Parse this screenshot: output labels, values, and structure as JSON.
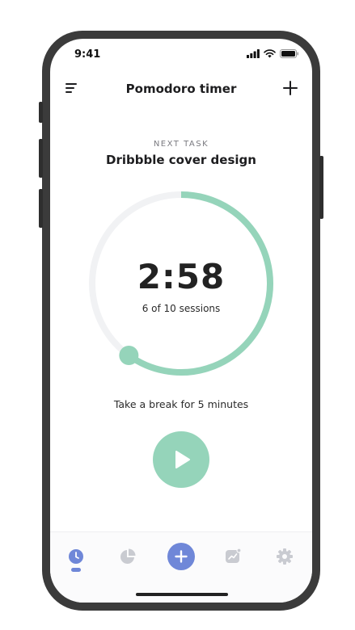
{
  "status_bar": {
    "time": "9:41",
    "icons": [
      "signal-icon",
      "wifi-icon",
      "battery-icon"
    ]
  },
  "header": {
    "title": "Pomodoro timer",
    "menu_icon": "menu-icon",
    "add_icon": "plus-icon"
  },
  "task": {
    "label": "NEXT TASK",
    "name": "Dribbble cover design"
  },
  "timer": {
    "time_left": "2:58",
    "sessions_text": "6 of 10 sessions",
    "progress_fraction": 0.6
  },
  "break_text": "Take a break for 5 minutes",
  "play_icon": "play-icon",
  "tabbar": {
    "tabs": [
      {
        "icon": "clock-icon",
        "active": true
      },
      {
        "icon": "pie-chart-icon",
        "active": false
      },
      {
        "icon": "plus-icon",
        "active": false
      },
      {
        "icon": "trend-chart-icon",
        "active": false
      },
      {
        "icon": "gear-icon",
        "active": false
      }
    ]
  },
  "colors": {
    "accent_green": "#95d4ba",
    "accent_blue": "#6f87d8",
    "track_gray": "#f1f2f4",
    "frame": "#3b3b3b"
  }
}
